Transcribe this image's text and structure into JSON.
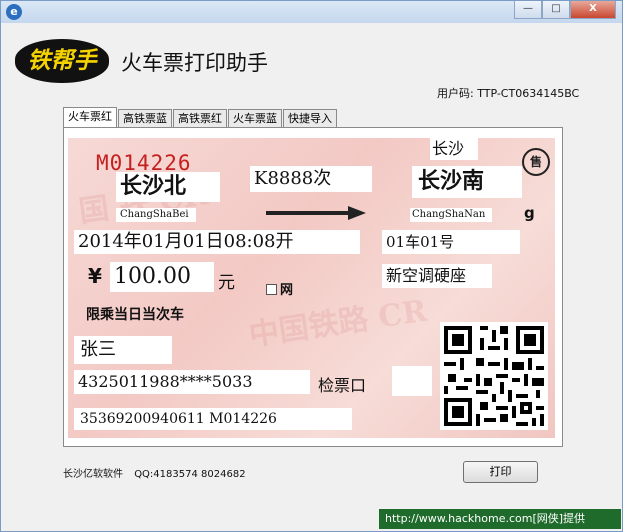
{
  "window": {
    "app_icon": "e",
    "minimize": "—",
    "maximize": "□",
    "close": "X"
  },
  "header": {
    "logo_text": "铁帮手",
    "app_title": "火车票打印助手",
    "user_code": "用户码: TTP-CT0634145BC"
  },
  "tabs": [
    "火车票红",
    "高铁票蓝",
    "高铁票红",
    "火车票蓝",
    "快捷导入"
  ],
  "ticket": {
    "serial": "M014226",
    "origin": "长沙北",
    "origin_pinyin": "ChangShaBei",
    "train_no": "K8888次",
    "dest_city": "长沙",
    "destination": "长沙南",
    "dest_pinyin": "ChangShaNan",
    "dest_pinyin_tail": "g",
    "seal": "售",
    "datetime": "2014年01月01日08:08开",
    "seat": "01车01号",
    "currency": "¥",
    "price": "100.00",
    "price_unit": "元",
    "net_label": "网",
    "seat_type": "新空调硬座",
    "restriction": "限乘当日当次车",
    "passenger": "张三",
    "id_number": "4325011988****5033",
    "gate_label": "检票口",
    "gate_value": "",
    "barcode": "35369200940611 M014226"
  },
  "footer": {
    "company": "长沙亿软软件",
    "qq": "QQ:4183574 8024682",
    "print_button": "打印"
  },
  "statusbar": {
    "text": "http://www.hackhome.com[网侠]提供"
  },
  "colors": {
    "ticket_bg": "#f3c9c4",
    "serial_red": "#c42020",
    "logo_yellow": "#f5d300",
    "status_green": "#1f6b2c"
  }
}
